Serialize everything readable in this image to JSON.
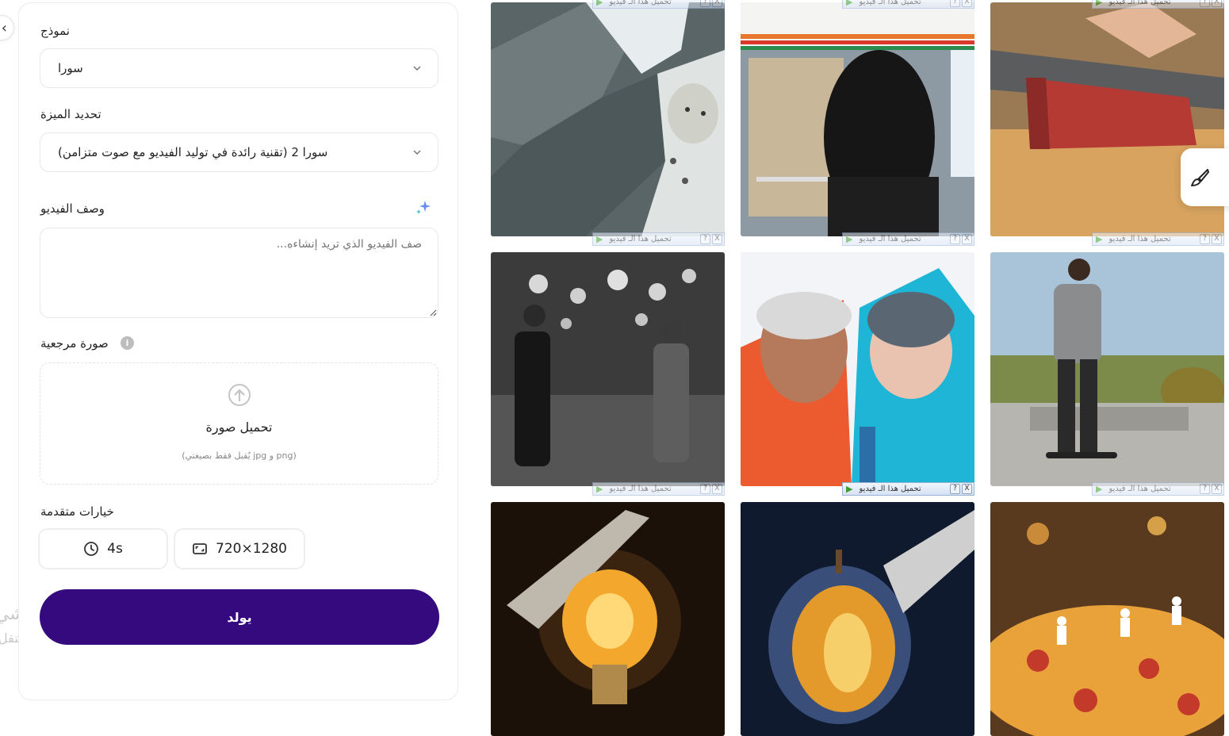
{
  "sidebar": {
    "collapse_icon": "chevron-left-icon",
    "ghost_line1": "تنشي",
    "ghost_line2": "انتقل"
  },
  "form": {
    "model_label": "نموذج",
    "model_value": "سورا",
    "feature_label": "تحديد الميزة",
    "feature_value": "سورا 2 (تقنية رائدة في توليد الفيديو مع صوت متزامن)",
    "description_label": "وصف الفيديو",
    "description_placeholder": "صف الفيديو الذي تريد إنشاءه...",
    "description_icon": "sparkle-icon",
    "reference_label": "صورة مرجعية",
    "reference_info": "i",
    "upload_title": "تحميل صورة",
    "upload_hint": "(يُقبل فقط بصيغتي jpg و png)",
    "advanced_label": "خيارات متقدمة",
    "duration_value": "4s",
    "resolution_value": "720×1280",
    "generate_label": "يولد",
    "accent_color": "#350a7e"
  },
  "gallery": {
    "download_bar_text": "تحميل هذا الـ فيديو",
    "download_q": "?",
    "download_x": "X",
    "items": [
      {
        "name": "snow-leopard-on-rocks"
      },
      {
        "name": "woman-at-convenience-store"
      },
      {
        "name": "knife-slicing-tuna"
      },
      {
        "name": "couple-in-rainy-street-bw"
      },
      {
        "name": "climbers-selfie-in-snow"
      },
      {
        "name": "man-on-skateboard"
      },
      {
        "name": "knife-cutting-lightbulb"
      },
      {
        "name": "knife-cutting-glass-apple"
      },
      {
        "name": "tiny-chefs-on-pizza"
      }
    ],
    "floating_button_icon": "brush-icon"
  }
}
